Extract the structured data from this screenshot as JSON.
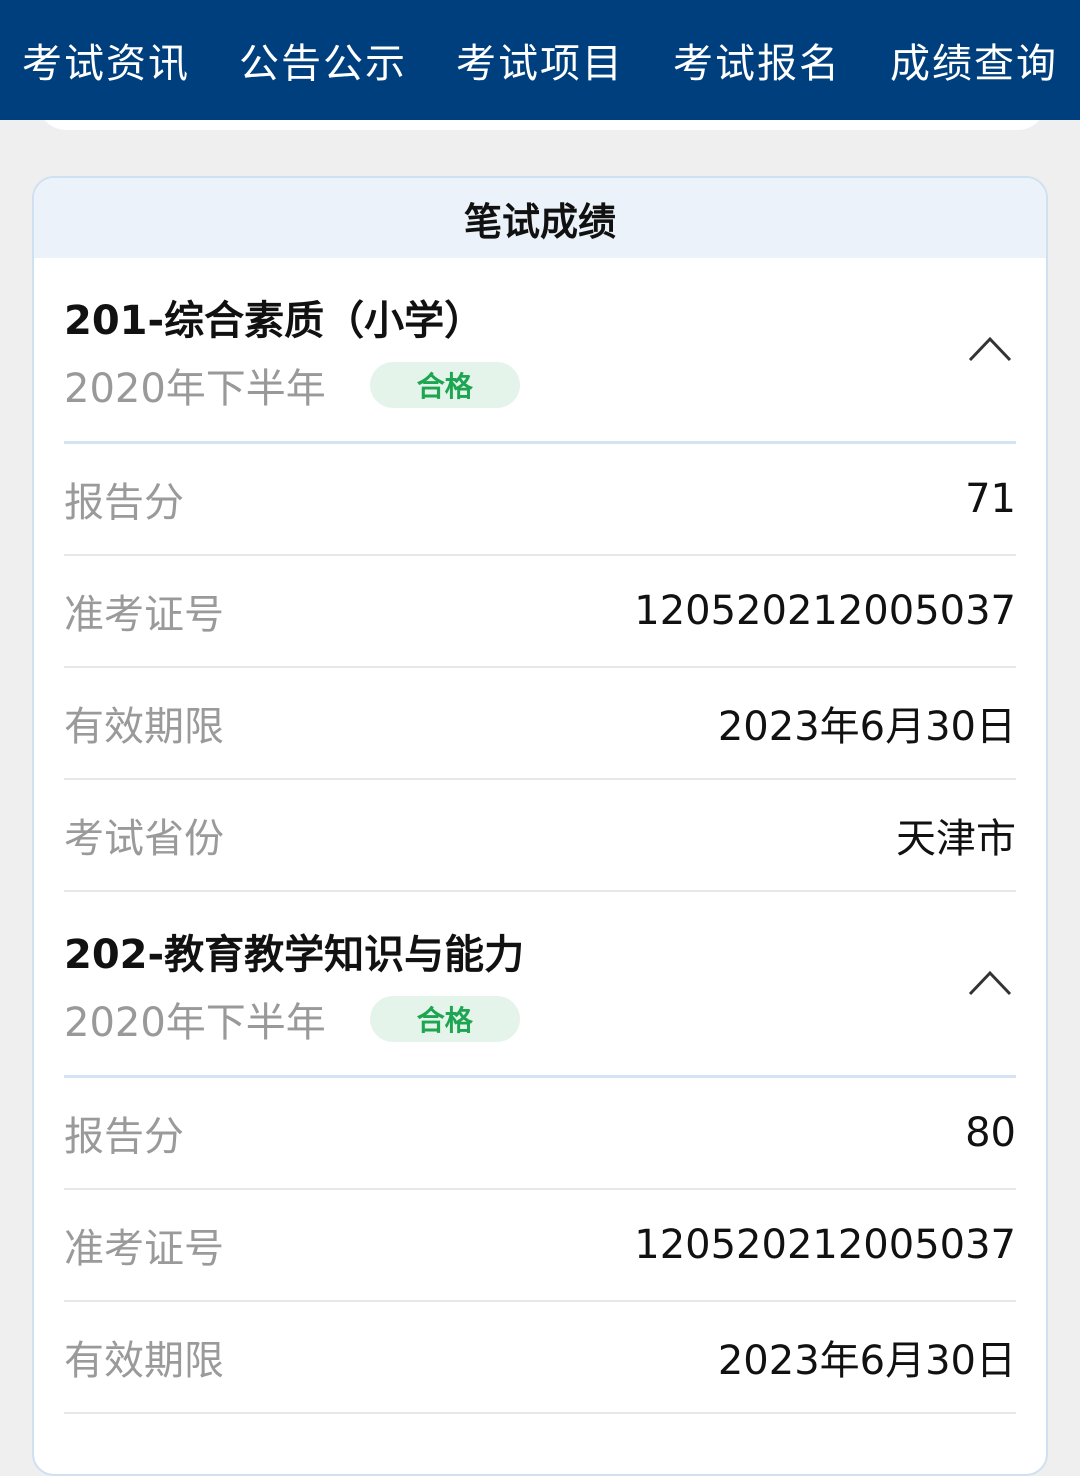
{
  "nav": {
    "items": [
      "考试资讯",
      "公告公示",
      "考试项目",
      "考试报名",
      "成绩查询"
    ]
  },
  "card": {
    "title": "笔试成绩"
  },
  "subjects": [
    {
      "title": "201-综合素质（小学）",
      "year": "2020年下半年",
      "status": "合格",
      "rows": [
        {
          "label": "报告分",
          "value": "71"
        },
        {
          "label": "准考证号",
          "value": "120520212005037"
        },
        {
          "label": "有效期限",
          "value": "2023年6月30日"
        },
        {
          "label": "考试省份",
          "value": "天津市"
        }
      ]
    },
    {
      "title": "202-教育教学知识与能力",
      "year": "2020年下半年",
      "status": "合格",
      "rows": [
        {
          "label": "报告分",
          "value": "80"
        },
        {
          "label": "准考证号",
          "value": "120520212005037"
        },
        {
          "label": "有效期限",
          "value": "2023年6月30日"
        }
      ]
    }
  ],
  "icons": {
    "collapse": "chevron-up-icon"
  },
  "colors": {
    "nav_bg": "#003f7d",
    "pass_text": "#1ea552",
    "pass_bg": "#e5f4ea"
  }
}
